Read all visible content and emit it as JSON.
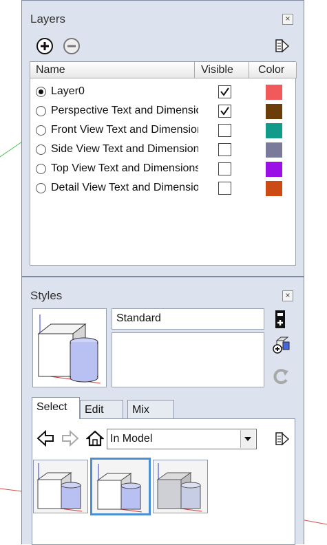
{
  "layers_panel": {
    "title": "Layers",
    "close_icon": "close-icon",
    "add_icon": "add-layer-icon",
    "remove_icon": "remove-layer-icon",
    "details_icon": "details-arrow-icon",
    "columns": {
      "name": "Name",
      "visible": "Visible",
      "color": "Color"
    },
    "layers": [
      {
        "name": "Layer0",
        "active": true,
        "visible": true,
        "color": "#f05a5a"
      },
      {
        "name": "Perspective Text and Dimensions",
        "active": false,
        "visible": true,
        "color": "#6b3d0a"
      },
      {
        "name": "Front View Text and Dimensions",
        "active": false,
        "visible": false,
        "color": "#129a8a"
      },
      {
        "name": "Side View Text and Dimensions",
        "active": false,
        "visible": false,
        "color": "#7a7a9a"
      },
      {
        "name": "Top View Text and Dimensions",
        "active": false,
        "visible": false,
        "color": "#9b10e6"
      },
      {
        "name": "Detail View Text and Dimensions",
        "active": false,
        "visible": false,
        "color": "#cc4a14"
      }
    ]
  },
  "styles_panel": {
    "title": "Styles",
    "close_icon": "close-icon",
    "style_name": "Standard",
    "style_description": "",
    "create_style_icon": "create-style-icon",
    "update_style_icon": "update-style-icon",
    "refresh_icon": "refresh-icon",
    "tabs": [
      {
        "label": "Select",
        "active": true
      },
      {
        "label": "Edit",
        "active": false
      },
      {
        "label": "Mix",
        "active": false
      }
    ],
    "nav": {
      "back_icon": "back-arrow-icon",
      "forward_icon": "forward-arrow-icon",
      "home_icon": "home-icon",
      "collection": "In Model",
      "details_icon": "details-arrow-icon"
    },
    "thumbnails": [
      {
        "icon": "style-thumbnail-icon",
        "selected": false
      },
      {
        "icon": "style-thumbnail-icon",
        "selected": true
      },
      {
        "icon": "style-thumbnail-icon",
        "selected": false
      }
    ]
  }
}
